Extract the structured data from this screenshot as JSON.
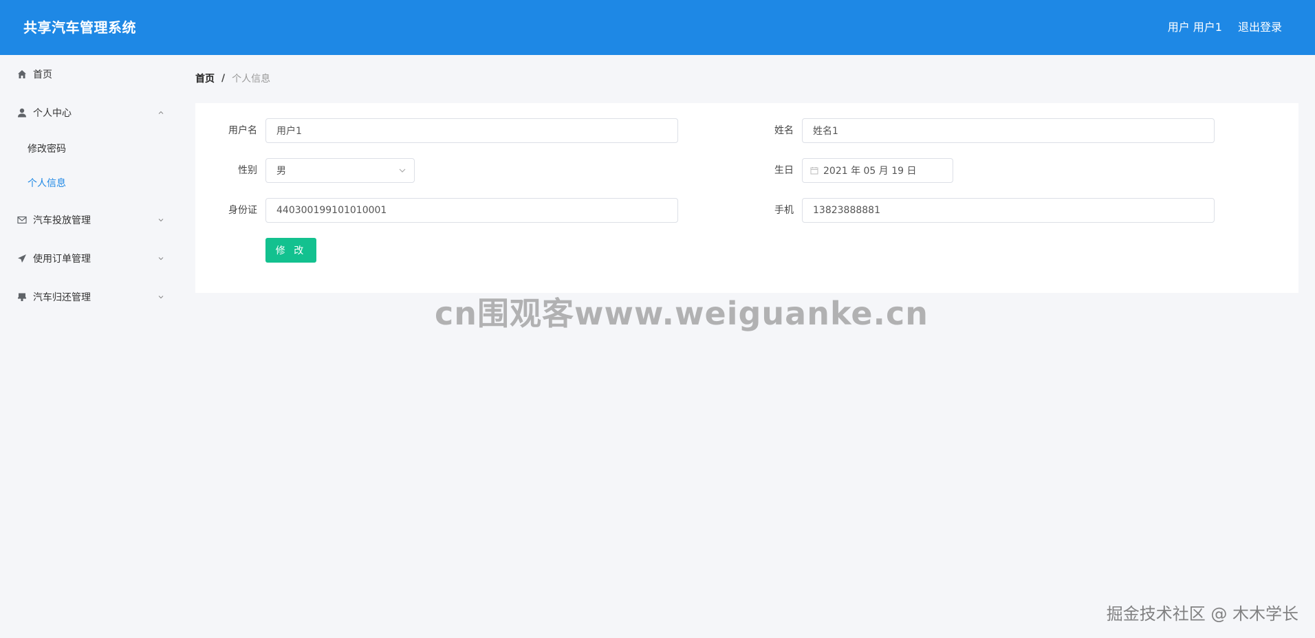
{
  "header": {
    "app_title": "共享汽车管理系统",
    "user_label": "用户 用户1",
    "logout_label": "退出登录",
    "background": "#1e88e5"
  },
  "sidebar": {
    "items": [
      {
        "label": "首页",
        "icon": "home-icon"
      },
      {
        "label": "个人中心",
        "icon": "user-icon",
        "expanded": true,
        "children": [
          {
            "label": "修改密码",
            "active": false
          },
          {
            "label": "个人信息",
            "active": true
          }
        ]
      },
      {
        "label": "汽车投放管理",
        "icon": "mail-icon",
        "expanded": false
      },
      {
        "label": "使用订单管理",
        "icon": "send-icon",
        "expanded": false
      },
      {
        "label": "汽车归还管理",
        "icon": "stamp-icon",
        "expanded": false
      }
    ]
  },
  "breadcrumb": {
    "home": "首页",
    "separator": "/",
    "current": "个人信息"
  },
  "form": {
    "username": {
      "label": "用户名",
      "value": "用户1"
    },
    "name": {
      "label": "姓名",
      "value": "姓名1"
    },
    "gender": {
      "label": "性别",
      "value": "男"
    },
    "birthday": {
      "label": "生日",
      "value": "2021 年 05 月 19 日"
    },
    "id_card": {
      "label": "身份证",
      "value": "440300199101010001"
    },
    "phone": {
      "label": "手机",
      "value": "13823888881"
    },
    "submit_label": "修 改",
    "submit_color": "#13c18f"
  },
  "watermarks": {
    "center": "cn围观客www.weiguanke.cn",
    "corner": "掘金技术社区 @ 木木学长"
  }
}
